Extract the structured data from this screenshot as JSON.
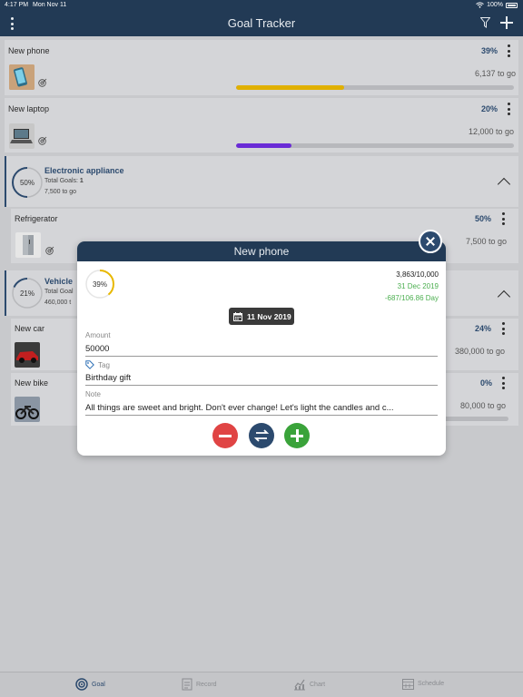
{
  "status": {
    "time": "4:17 PM",
    "date": "Mon Nov 11",
    "battery": "100%"
  },
  "nav": {
    "title": "Goal Tracker"
  },
  "goals": [
    {
      "name": "New phone",
      "percent": "39%",
      "remaining": "6,137 to go",
      "progress": 0.39,
      "color": "#e0b000"
    },
    {
      "name": "New laptop",
      "percent": "20%",
      "remaining": "12,000 to go",
      "progress": 0.2,
      "color": "#6a2bd6"
    }
  ],
  "groups": [
    {
      "name": "Electronic appliance",
      "ring_label": "50%",
      "total_label": "Total Goals:",
      "total_value": "1",
      "remaining": "7,500 to go"
    },
    {
      "name": "Vehicle",
      "ring_label": "21%",
      "total_label": "Total Goal",
      "remaining": "460,000 t"
    }
  ],
  "sub_goals": [
    {
      "name": "Refrigerator",
      "percent": "50%",
      "remaining": "7,500 to go"
    },
    {
      "name": "New car",
      "percent": "24%",
      "remaining": "380,000 to go"
    },
    {
      "name": "New bike",
      "percent": "0%",
      "remaining": "80,000 to go"
    }
  ],
  "modal": {
    "title": "New phone",
    "ring_label": "39%",
    "progress": 0.39,
    "amount_summary": "3,863/10,000",
    "target_date": "31 Dec 2019",
    "per_day": "-687/106.86 Day",
    "entry_date": "11 Nov 2019",
    "amount_label": "Amount",
    "amount_value": "50000",
    "tag_label": "Tag",
    "tag_value": "Birthday gift",
    "note_label": "Note",
    "note_value": "All things are sweet and bright. Don't ever change! Let's light the candles and c..."
  },
  "tabs": [
    {
      "label": "Goal",
      "icon": "target-icon",
      "active": true
    },
    {
      "label": "Record",
      "icon": "record-icon",
      "active": false
    },
    {
      "label": "Chart",
      "icon": "chart-icon",
      "active": false
    },
    {
      "label": "Schedule",
      "icon": "calendar-icon",
      "active": false
    }
  ],
  "colors": {
    "navy": "#223a55",
    "accent": "#2c4a6e",
    "green": "#4caf50",
    "red": "#e04444"
  }
}
